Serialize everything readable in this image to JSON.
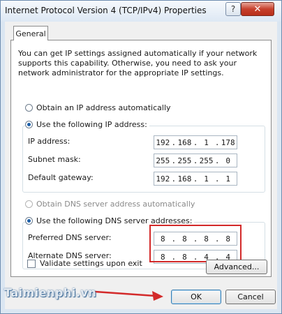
{
  "window": {
    "title": "Internet Protocol Version 4 (TCP/IPv4) Properties",
    "help_label": "?",
    "close_label": "✕"
  },
  "tabs": [
    {
      "label": "General"
    }
  ],
  "description": "You can get IP settings assigned automatically if your network supports this capability. Otherwise, you need to ask your network administrator for the appropriate IP settings.",
  "ip_section": {
    "auto_label": "Obtain an IP address automatically",
    "manual_label": "Use the following IP address:",
    "selected": "manual",
    "fields": [
      {
        "label": "IP address:",
        "octets": [
          "192",
          "168",
          "1",
          "178"
        ]
      },
      {
        "label": "Subnet mask:",
        "octets": [
          "255",
          "255",
          "255",
          "0"
        ]
      },
      {
        "label": "Default gateway:",
        "octets": [
          "192",
          "168",
          "1",
          "1"
        ]
      }
    ]
  },
  "dns_section": {
    "auto_label": "Obtain DNS server address automatically",
    "manual_label": "Use the following DNS server addresses:",
    "selected": "manual",
    "fields": [
      {
        "label": "Preferred DNS server:",
        "octets": [
          "8",
          "8",
          "8",
          "8"
        ]
      },
      {
        "label": "Alternate DNS server:",
        "octets": [
          "8",
          "8",
          "4",
          "4"
        ]
      }
    ]
  },
  "validate_label": "Validate settings upon exit",
  "validate_checked": false,
  "buttons": {
    "advanced": "Advanced...",
    "ok": "OK",
    "cancel": "Cancel"
  },
  "watermark": "Taimienphi.vn",
  "colors": {
    "highlight": "#d32a2a",
    "arrow": "#d32a2a",
    "radio_dot": "#1c5fa8"
  }
}
